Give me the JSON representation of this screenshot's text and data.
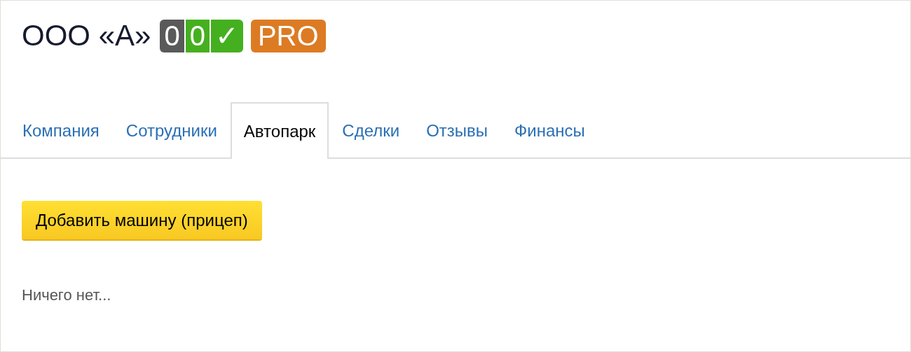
{
  "title": "ООО «А»",
  "badges": [
    {
      "text": "0",
      "color": "#5a5a5a"
    },
    {
      "text": "0",
      "color": "#44b01f"
    },
    {
      "text": "✓",
      "color": "#44b01f"
    }
  ],
  "plan_badge": {
    "text": "PRO",
    "color": "#dc7b23"
  },
  "tabs": [
    {
      "label": "Компания",
      "selected": false
    },
    {
      "label": "Сотрудники",
      "selected": false
    },
    {
      "label": "Автопарк",
      "selected": true
    },
    {
      "label": "Сделки",
      "selected": false
    },
    {
      "label": "Отзывы",
      "selected": false
    },
    {
      "label": "Финансы",
      "selected": false
    }
  ],
  "add_button": "Добавить машину (прицеп)",
  "empty_message": "Ничего нет..."
}
